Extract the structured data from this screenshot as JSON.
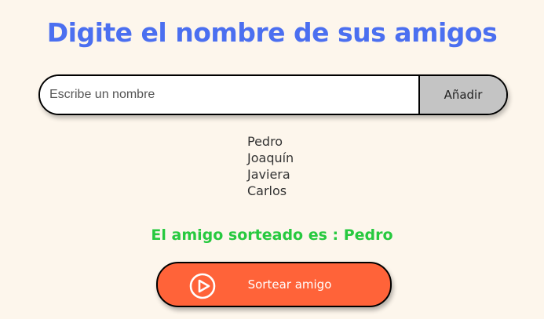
{
  "header": {
    "title": "Digite el nombre de sus amigos"
  },
  "form": {
    "input_placeholder": "Escribe un nombre",
    "input_value": "",
    "add_label": "Añadir"
  },
  "friends": [
    "Pedro",
    "Joaquín",
    "Javiera",
    "Carlos"
  ],
  "result": {
    "text": "El amigo sorteado es : Pedro"
  },
  "draw": {
    "label": "Sortear amigo",
    "icon": "play-circle-icon"
  },
  "colors": {
    "background": "#fdf6ec",
    "title": "#4b6ff0",
    "result": "#27c93f",
    "draw_button": "#ff6339",
    "add_button": "#c4c4c4"
  }
}
